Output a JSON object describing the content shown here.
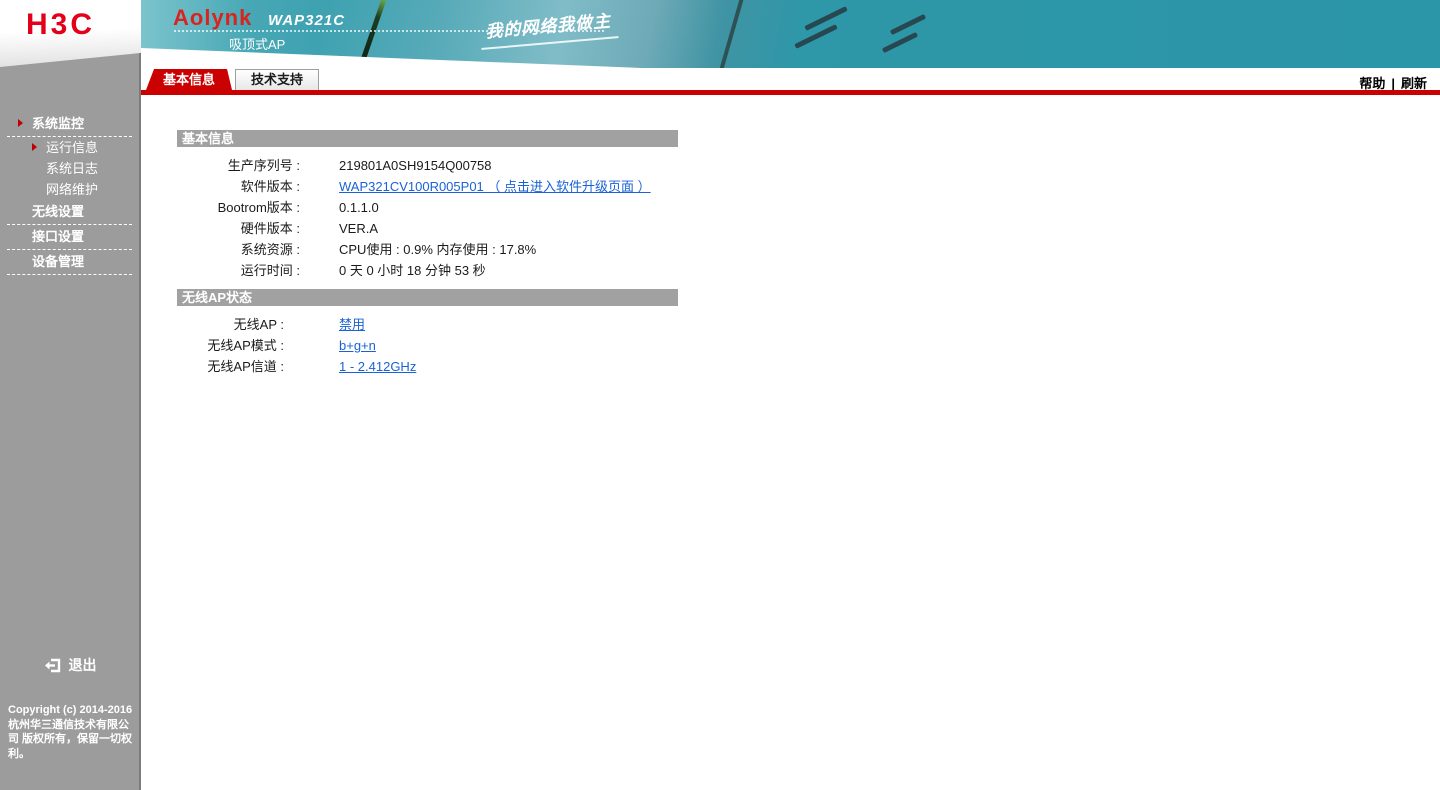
{
  "brand": {
    "logo": "H3C"
  },
  "banner": {
    "product": "Aolynk",
    "model": "WAP321C",
    "subtitle": "吸顶式AP",
    "slogan": "我的网络我做主"
  },
  "topbar": {
    "tabs": [
      {
        "name": "basic-info",
        "label": "基本信息",
        "active": true
      },
      {
        "name": "tech-support",
        "label": "技术支持",
        "active": false
      }
    ],
    "help_label": "帮助",
    "divider": "|",
    "refresh_label": "刷新"
  },
  "sidebar": {
    "groups": [
      {
        "name": "system-monitor",
        "label": "系统监控",
        "expanded": true,
        "items": [
          {
            "name": "running-info",
            "label": "运行信息",
            "active": true
          },
          {
            "name": "system-log",
            "label": "系统日志",
            "active": false
          },
          {
            "name": "network-maintenance",
            "label": "网络维护",
            "active": false
          }
        ]
      },
      {
        "name": "wireless-settings",
        "label": "无线设置",
        "expanded": false,
        "items": []
      },
      {
        "name": "interface-settings",
        "label": "接口设置",
        "expanded": false,
        "items": []
      },
      {
        "name": "device-management",
        "label": "设备管理",
        "expanded": false,
        "items": []
      }
    ],
    "logout_label": "退出",
    "copyright": "Copyright (c) 2014-2016  杭州华三通信技术有限公司 版权所有，保留一切权利。"
  },
  "sections": [
    {
      "name": "basic-info",
      "title": "基本信息",
      "rows": [
        {
          "name": "serial-number",
          "label": "生产序列号 :",
          "value": "219801A0SH9154Q00758",
          "link": false
        },
        {
          "name": "software-version",
          "label": "软件版本 :",
          "value": "WAP321CV100R005P01 （ 点击进入软件升级页面 ）",
          "link": true
        },
        {
          "name": "bootrom-version",
          "label": "Bootrom版本 :",
          "value": "0.1.1.0",
          "link": false
        },
        {
          "name": "hardware-version",
          "label": "硬件版本 :",
          "value": "VER.A",
          "link": false
        },
        {
          "name": "system-resources",
          "label": "系统资源 :",
          "value": "CPU使用 : 0.9%   内存使用 : 17.8%",
          "link": false
        },
        {
          "name": "uptime",
          "label": "运行时间 :",
          "value": "0 天 0 小时 18 分钟 53 秒",
          "link": false
        }
      ]
    },
    {
      "name": "wireless-ap-status",
      "title": "无线AP状态",
      "rows": [
        {
          "name": "wireless-ap",
          "label": "无线AP :",
          "value": "禁用",
          "link": true
        },
        {
          "name": "wireless-ap-mode",
          "label": "无线AP模式 :",
          "value": "b+g+n",
          "link": true
        },
        {
          "name": "wireless-ap-channel",
          "label": "无线AP信道 :",
          "value": "1 - 2.412GHz",
          "link": true
        }
      ]
    }
  ],
  "colors": {
    "accent_red": "#cb0000",
    "brand_red": "#e2001a",
    "banner_teal": "#2b96a8",
    "sidebar_gray": "#9c9c9c",
    "section_bar_gray": "#a1a1a1",
    "link_blue": "#1a62d6"
  }
}
